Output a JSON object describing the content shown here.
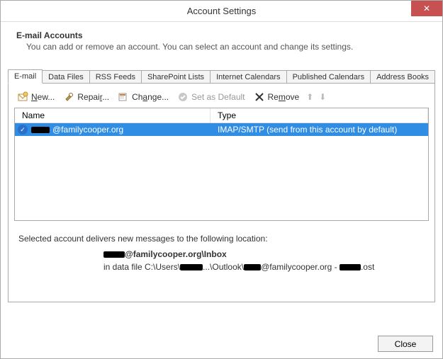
{
  "window": {
    "title": "Account Settings",
    "close_glyph": "✕"
  },
  "header": {
    "title": "E-mail Accounts",
    "subtitle": "You can add or remove an account. You can select an account and change its settings."
  },
  "tabs": [
    {
      "id": "email",
      "label": "E-mail",
      "active": true
    },
    {
      "id": "datafiles",
      "label": "Data Files",
      "active": false
    },
    {
      "id": "rss",
      "label": "RSS Feeds",
      "active": false
    },
    {
      "id": "sharepoint",
      "label": "SharePoint Lists",
      "active": false
    },
    {
      "id": "ical",
      "label": "Internet Calendars",
      "active": false
    },
    {
      "id": "pubcal",
      "label": "Published Calendars",
      "active": false
    },
    {
      "id": "addr",
      "label": "Address Books",
      "active": false
    }
  ],
  "toolbar": {
    "new_label": "New...",
    "repair_label": "Repair...",
    "change_label": "Change...",
    "default_label": "Set as Default",
    "remove_label": "Remove"
  },
  "columns": {
    "name": "Name",
    "type": "Type"
  },
  "accounts": [
    {
      "name_suffix": "@familycooper.org",
      "type": "IMAP/SMTP (send from this account by default)",
      "is_default": true,
      "selected": true
    }
  ],
  "footer": {
    "intro": "Selected account delivers new messages to the following location:",
    "loc_suffix": "@familycooper.org\\Inbox",
    "path_prefix": "in data file C:\\Users\\",
    "path_mid": "...\\Outlook\\",
    "path_suffix": "@familycooper.org - ",
    "path_ext": ".ost"
  },
  "buttons": {
    "close": "Close"
  }
}
